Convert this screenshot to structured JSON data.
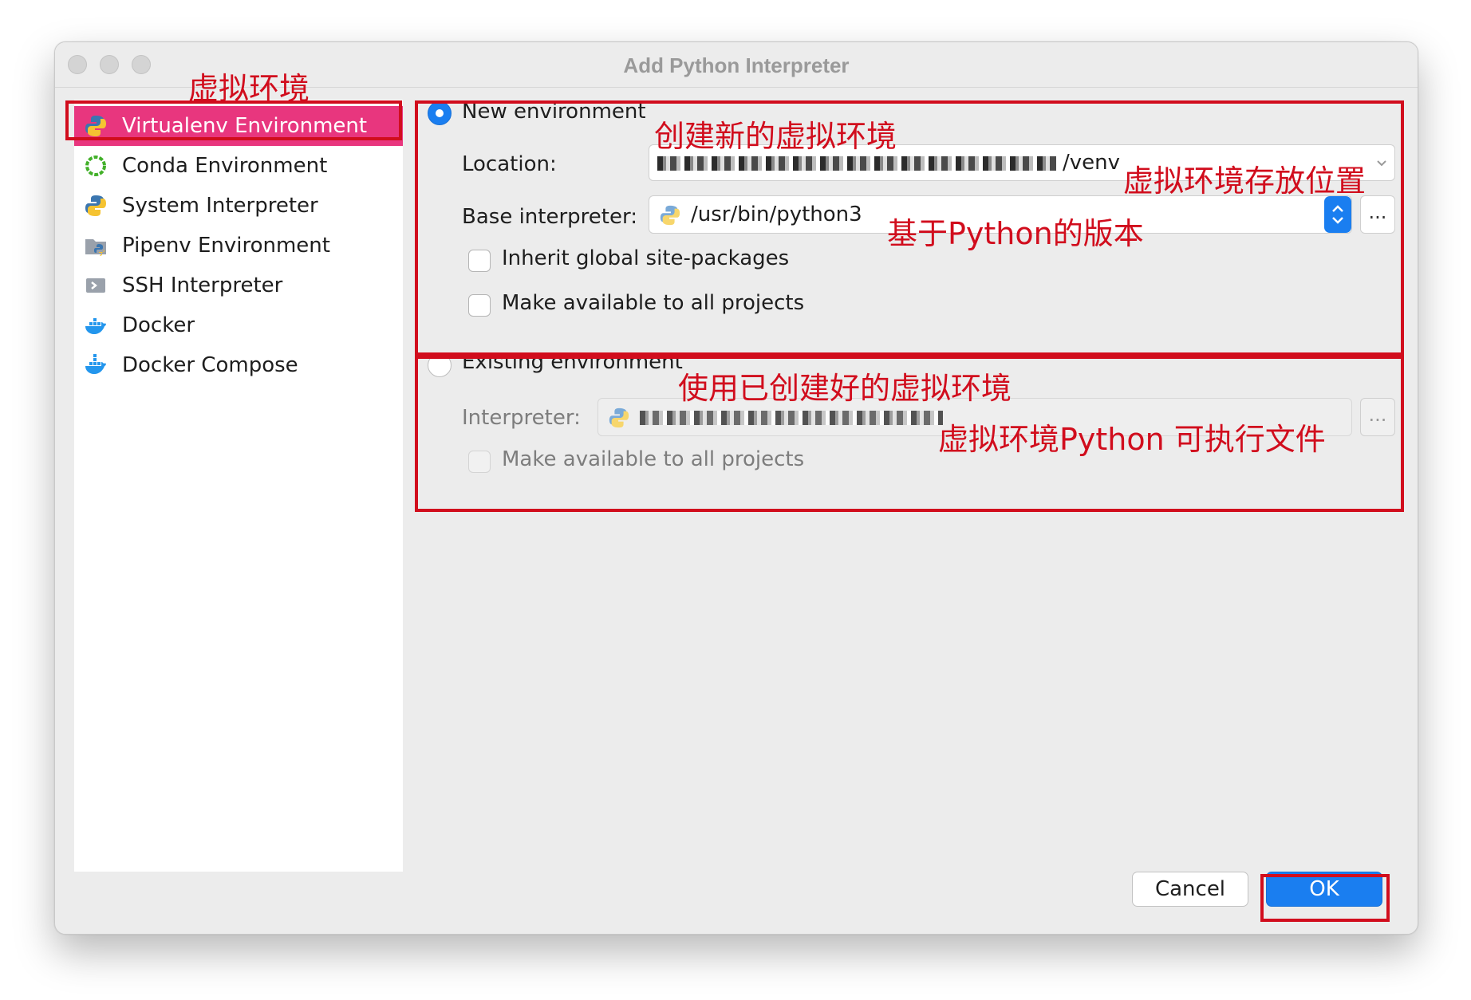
{
  "window": {
    "title": "Add Python Interpreter"
  },
  "sidebar": {
    "items": [
      {
        "label": "Virtualenv Environment",
        "icon": "python-icon",
        "selected": true
      },
      {
        "label": "Conda Environment",
        "icon": "conda-icon"
      },
      {
        "label": "System Interpreter",
        "icon": "python-icon"
      },
      {
        "label": "Pipenv Environment",
        "icon": "pipenv-icon"
      },
      {
        "label": "SSH Interpreter",
        "icon": "ssh-icon"
      },
      {
        "label": "Docker",
        "icon": "docker-icon"
      },
      {
        "label": "Docker Compose",
        "icon": "docker-compose-icon"
      }
    ]
  },
  "new_env": {
    "radio_label": "New environment",
    "selected": true,
    "location_label": "Location:",
    "location_value_suffix": "/venv",
    "base_label": "Base interpreter:",
    "base_value": "/usr/bin/python3",
    "inherit_label": "Inherit global site-packages",
    "make_available_label": "Make available to all projects"
  },
  "existing_env": {
    "radio_label": "Existing environment",
    "interpreter_label": "Interpreter:",
    "make_available_label": "Make available to all projects"
  },
  "buttons": {
    "cancel": "Cancel",
    "ok": "OK",
    "browse": "..."
  },
  "annotations": {
    "virtualenv": "虚拟环境",
    "new_env": "创建新的虚拟环境",
    "location": "虚拟环境存放位置",
    "base": "基于Python的版本",
    "existing": "使用已创建好的虚拟环境",
    "interpreter": "虚拟环境Python 可执行文件"
  },
  "colors": {
    "accent": "#1a7ef0",
    "selection": "#e8367e",
    "annotation": "#d10d1d"
  }
}
